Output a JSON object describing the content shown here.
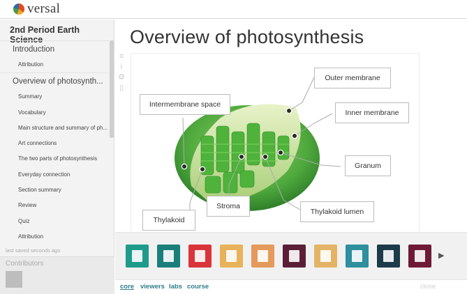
{
  "app": {
    "logo_text": "versal"
  },
  "sidebar": {
    "course_title": "2nd Period Earth Science",
    "items": [
      {
        "label": "Introduction",
        "level": 1
      },
      {
        "label": "Attribution",
        "level": 2
      },
      {
        "label": "Overview of photosynth...",
        "level": 1
      },
      {
        "label": "Summary",
        "level": 2
      },
      {
        "label": "Vocabulary",
        "level": 2
      },
      {
        "label": "Main structure and summary of ph...",
        "level": 2
      },
      {
        "label": "Art connections",
        "level": 2
      },
      {
        "label": "The two parts of photosynthesis",
        "level": 2
      },
      {
        "label": "Everyday connection",
        "level": 2
      },
      {
        "label": "Section summary",
        "level": 2
      },
      {
        "label": "Review",
        "level": 2
      },
      {
        "label": "Quiz",
        "level": 2
      },
      {
        "label": "Attribution",
        "level": 2
      }
    ],
    "saved_status": "last saved seconds ago",
    "contributors_label": "Contributors"
  },
  "main": {
    "title": "Overview of photosynthesis",
    "tool_icons": [
      "menu-icon",
      "info-icon",
      "gear-icon",
      "trash-icon"
    ],
    "figure": {
      "labels": {
        "outer_membrane": "Outer membrane",
        "intermembrane_space": "Intermembrane space",
        "inner_membrane": "Inner membrane",
        "granum": "Granum",
        "stroma": "Stroma",
        "thylakoid_lumen": "Thylakoid lumen",
        "thylakoid": "Thylakoid"
      }
    }
  },
  "tray": {
    "gadgets": [
      {
        "icon": "layout-gadget-icon",
        "color": "#1e9b8a"
      },
      {
        "icon": "text-gadget-icon",
        "color": "#1a7f7a"
      },
      {
        "icon": "image-gadget-icon",
        "color": "#d9343a"
      },
      {
        "icon": "list-gadget-icon",
        "color": "#e8b25a"
      },
      {
        "icon": "grid-gadget-icon",
        "color": "#e49a5b"
      },
      {
        "icon": "timeline-gadget-icon",
        "color": "#5a1f36"
      },
      {
        "icon": "media-gadget-icon",
        "color": "#e4b466"
      },
      {
        "icon": "map-gadget-icon",
        "color": "#2e8f9e"
      },
      {
        "icon": "cards-gadget-icon",
        "color": "#1d3a4a"
      },
      {
        "icon": "annotated-image-gadget-icon",
        "color": "#6e1a36"
      }
    ],
    "next_arrow": "▶"
  },
  "tabs": {
    "items": [
      "core",
      "viewers",
      "labs",
      "course"
    ],
    "close_label": "close"
  }
}
